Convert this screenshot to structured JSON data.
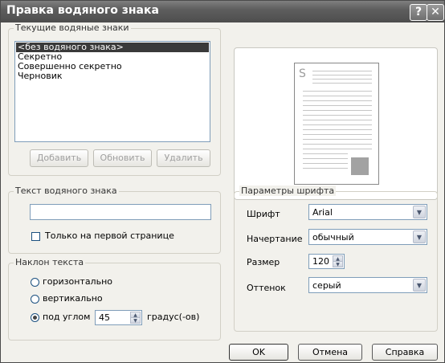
{
  "window": {
    "title": "Правка водяного знака",
    "help_glyph": "?",
    "close_glyph": "✕"
  },
  "watermarks": {
    "group_label": "Текущие водяные знаки",
    "items": [
      "<без водяного знака>",
      "Секретно",
      "Совершенно секретно",
      "Черновик"
    ],
    "selected_index": 0,
    "add_label": "Добавить",
    "update_label": "Обновить",
    "delete_label": "Удалить"
  },
  "preview": {
    "logo_glyph": "S"
  },
  "watermark_text": {
    "group_label": "Текст водяного знака",
    "value": "",
    "first_page_only_label": "Только на первой странице",
    "first_page_only_checked": false
  },
  "tilt": {
    "group_label": "Наклон текста",
    "horizontal_label": "горизонтально",
    "vertical_label": "вертикально",
    "angle_label": "под углом",
    "selected": "angle",
    "angle_value": "45",
    "degrees_label": "градус(-ов)"
  },
  "font": {
    "group_label": "Параметры шрифта",
    "font_label": "Шрифт",
    "font_value": "Arial",
    "style_label": "Начертание",
    "style_value": "обычный",
    "size_label": "Размер",
    "size_value": "120",
    "shade_label": "Оттенок",
    "shade_value": "серый"
  },
  "buttons": {
    "ok_label": "OK",
    "cancel_label": "Отмена",
    "help_label": "Справка"
  }
}
